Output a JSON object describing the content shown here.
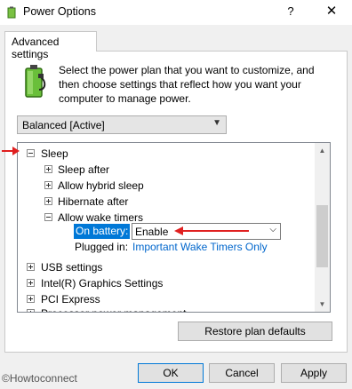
{
  "window": {
    "title": "Power Options",
    "help_label": "?",
    "close_label": "✕",
    "icon": "power-options-icon"
  },
  "tab": {
    "label": "Advanced settings"
  },
  "description": "Select the power plan that you want to customize, and then choose settings that reflect how you want your computer to manage power.",
  "plan_select": {
    "value": "Balanced [Active]"
  },
  "tree": {
    "items": [
      {
        "label": "Sleep",
        "state": "expanded"
      },
      {
        "label": "Sleep after",
        "state": "collapsed"
      },
      {
        "label": "Allow hybrid sleep",
        "state": "collapsed"
      },
      {
        "label": "Hibernate after",
        "state": "collapsed"
      },
      {
        "label": "Allow wake timers",
        "state": "expanded"
      },
      {
        "label": "USB settings",
        "state": "collapsed"
      },
      {
        "label": "Intel(R) Graphics Settings",
        "state": "collapsed"
      },
      {
        "label": "PCI Express",
        "state": "collapsed"
      },
      {
        "label": "Processor power management",
        "state": "collapsed"
      }
    ],
    "on_battery": {
      "label": "On battery:",
      "value": "Enable"
    },
    "plugged_in": {
      "label": "Plugged in:",
      "value": "Important Wake Timers Only"
    }
  },
  "buttons": {
    "restore": "Restore plan defaults",
    "ok": "OK",
    "cancel": "Cancel",
    "apply": "Apply"
  },
  "watermark": "©Howtoconnect",
  "colors": {
    "selection": "#0078d7",
    "link": "#0066cc",
    "annotation_arrow": "#e02020"
  }
}
